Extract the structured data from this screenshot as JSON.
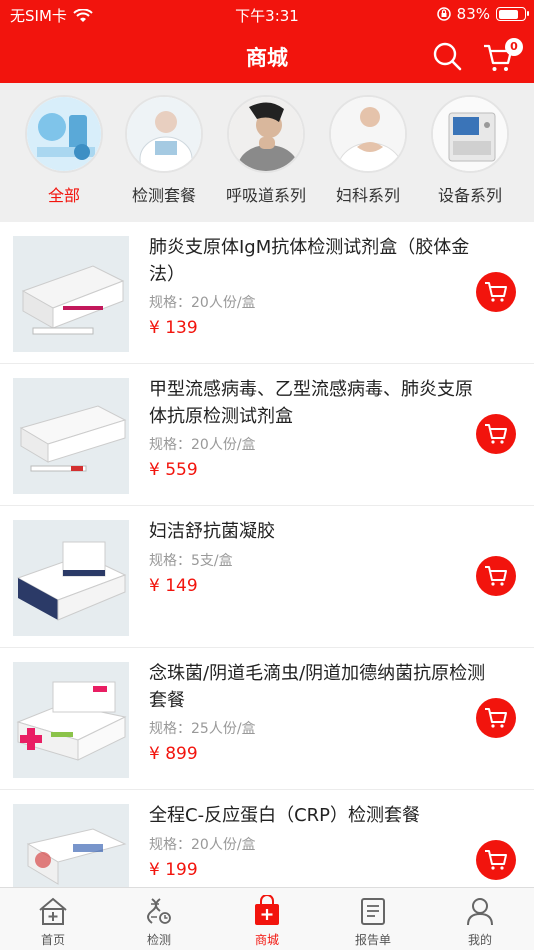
{
  "status_bar": {
    "carrier": "无SIM卡",
    "time": "下午3:31",
    "battery": "83%",
    "battery_level": 0.83
  },
  "header": {
    "title": "商城",
    "cart_count": "0",
    "icons": [
      "search-icon",
      "cart-icon"
    ]
  },
  "categories": [
    {
      "label": "全部",
      "active": true
    },
    {
      "label": "检测套餐",
      "active": false
    },
    {
      "label": "呼吸道系列",
      "active": false
    },
    {
      "label": "妇科系列",
      "active": false
    },
    {
      "label": "设备系列",
      "active": false
    }
  ],
  "products": [
    {
      "name": "肺炎支原体IgM抗体检测试剂盒（胶体金法）",
      "spec": "规格：20人份/盒",
      "price": "¥ 139"
    },
    {
      "name": "甲型流感病毒、乙型流感病毒、肺炎支原体抗原检测试剂盒",
      "spec": "规格：20人份/盒",
      "price": "¥ 559"
    },
    {
      "name": "妇洁舒抗菌凝胶",
      "spec": "规格：5支/盒",
      "price": "¥ 149"
    },
    {
      "name": "念珠菌/阴道毛滴虫/阴道加德纳菌抗原检测套餐",
      "spec": "规格：25人份/盒",
      "price": "¥ 899"
    },
    {
      "name": "全程C-反应蛋白（CRP）检测套餐",
      "spec": "规格：20人份/盒",
      "price": "¥ 199"
    }
  ],
  "tabbar": [
    {
      "label": "首页",
      "icon": "home-icon",
      "active": false
    },
    {
      "label": "检测",
      "icon": "test-icon",
      "active": false
    },
    {
      "label": "商城",
      "icon": "shop-icon",
      "active": true
    },
    {
      "label": "报告单",
      "icon": "report-icon",
      "active": false
    },
    {
      "label": "我的",
      "icon": "profile-icon",
      "active": false
    }
  ],
  "colors": {
    "accent": "#f2140d",
    "background": "#efefef"
  }
}
